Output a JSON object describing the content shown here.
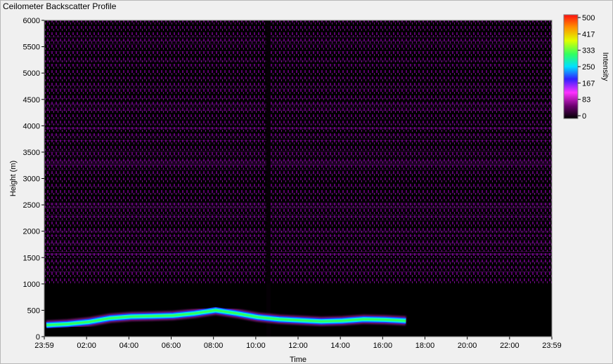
{
  "window": {
    "title": "Ceilometer Backscatter Profile"
  },
  "colors": {
    "background": "#000000",
    "haze": "#a000c0",
    "layer": "#30ff60",
    "accent": "#ff40ff"
  },
  "chart_data": {
    "type": "heatmap",
    "title": "Ceilometer Backscatter Profile",
    "xlabel": "Time",
    "ylabel": "Height (m)",
    "xlim": [
      "23:59",
      "23:59"
    ],
    "ylim": [
      0,
      6000
    ],
    "x_ticks": [
      "23:59",
      "02:00",
      "04:00",
      "06:00",
      "08:00",
      "10:00",
      "12:00",
      "14:00",
      "16:00",
      "18:00",
      "20:00",
      "22:00",
      "23:59"
    ],
    "y_ticks": [
      "0",
      "500",
      "1000",
      "1500",
      "2000",
      "2500",
      "3000",
      "3500",
      "4000",
      "4500",
      "5000",
      "5500",
      "6000"
    ],
    "colorbar": {
      "label": "Intensity",
      "ticks": [
        "500",
        "417",
        "333",
        "250",
        "167",
        "83",
        "0"
      ],
      "range": [
        0,
        500
      ]
    },
    "boundary_layer": {
      "hours": [
        0,
        1,
        2,
        3,
        4,
        5,
        6,
        7,
        8,
        9,
        10,
        11,
        12,
        13,
        14,
        15,
        16,
        17
      ],
      "height_m": [
        220,
        240,
        280,
        350,
        380,
        390,
        400,
        440,
        500,
        440,
        370,
        330,
        310,
        290,
        300,
        330,
        320,
        300
      ],
      "intensity": 330
    },
    "data_gap_hours": [
      10.5,
      10.7
    ],
    "grid": false,
    "legend": "colorbar-right"
  }
}
